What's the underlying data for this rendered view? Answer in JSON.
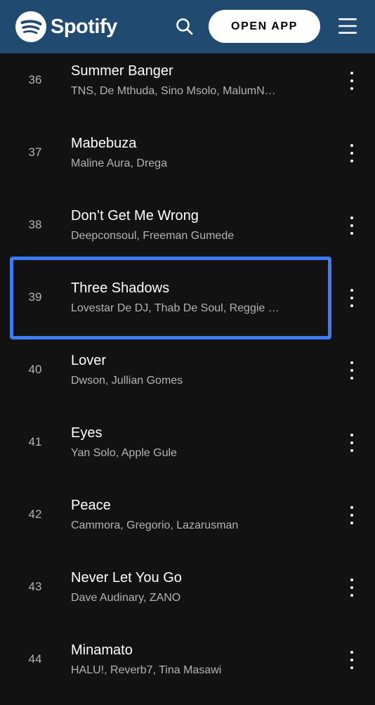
{
  "header": {
    "brand": "Spotify",
    "open_app_label": "OPEN APP",
    "icons": {
      "logo": "spotify-logo-icon",
      "search": "search-icon",
      "menu": "hamburger-menu-icon"
    },
    "colors": {
      "bar": "#214a70",
      "button_bg": "#ffffff"
    }
  },
  "tracks": [
    {
      "number": "36",
      "title": "Summer Banger",
      "artists": "TNS, De Mthuda, Sino Msolo, MalumN…"
    },
    {
      "number": "37",
      "title": "Mabebuza",
      "artists": "Maline Aura, Drega"
    },
    {
      "number": "38",
      "title": "Don’t Get Me Wrong",
      "artists": "Deepconsoul, Freeman Gumede"
    },
    {
      "number": "39",
      "title": "Three Shadows",
      "artists": "Lovestar De DJ, Thab De Soul, Reggie …",
      "highlighted": true
    },
    {
      "number": "40",
      "title": "Lover",
      "artists": "Dwson, Jullian Gomes"
    },
    {
      "number": "41",
      "title": "Eyes",
      "artists": "Yan Solo, Apple Gule"
    },
    {
      "number": "42",
      "title": "Peace",
      "artists": "Cammora, Gregorio, Lazarusman"
    },
    {
      "number": "43",
      "title": "Never Let You Go",
      "artists": "Dave Audinary, ZANO"
    },
    {
      "number": "44",
      "title": "Minamato",
      "artists": "HALU!, Reverb7, Tina Masawi"
    }
  ],
  "theme": {
    "background": "#121212",
    "text_primary": "#ffffff",
    "text_secondary": "#b3b3b3",
    "highlight_border": "#3d7bf5"
  }
}
